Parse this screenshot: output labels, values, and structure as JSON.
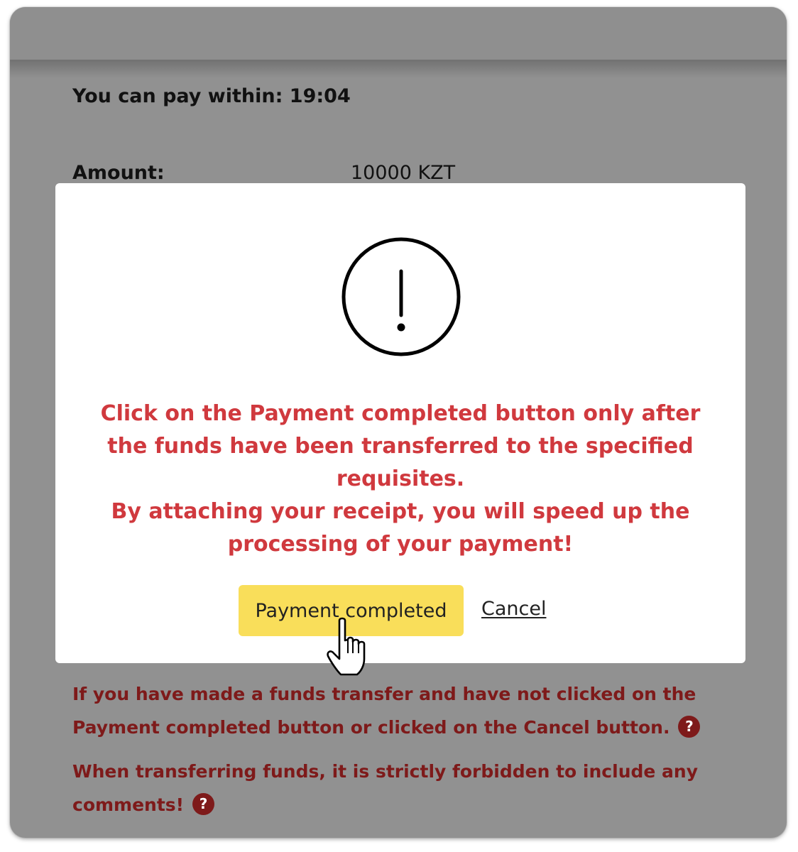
{
  "payment": {
    "timer_label": "You can pay within: 19:04",
    "amount_label": "Amount:",
    "amount_value": "10000 KZT"
  },
  "modal": {
    "icon": "exclamation-circle-icon",
    "message_line1": "Click on the Payment completed button only after the funds have been transferred to the specified requisites.",
    "message_line2": "By attaching your receipt, you will speed up the processing of your payment!",
    "primary_button": "Payment completed",
    "cancel_link": "Cancel",
    "message_color": "#d0393e",
    "button_color": "#f9de5a"
  },
  "notes": [
    {
      "text": "If you have made a funds transfer and have not clicked on the Payment completed button or clicked on the Cancel button.",
      "help_icon": "?"
    },
    {
      "text": "When transferring funds, it is strictly forbidden to include any comments!",
      "help_icon": "?"
    }
  ],
  "cursor": "hand-pointer-icon"
}
